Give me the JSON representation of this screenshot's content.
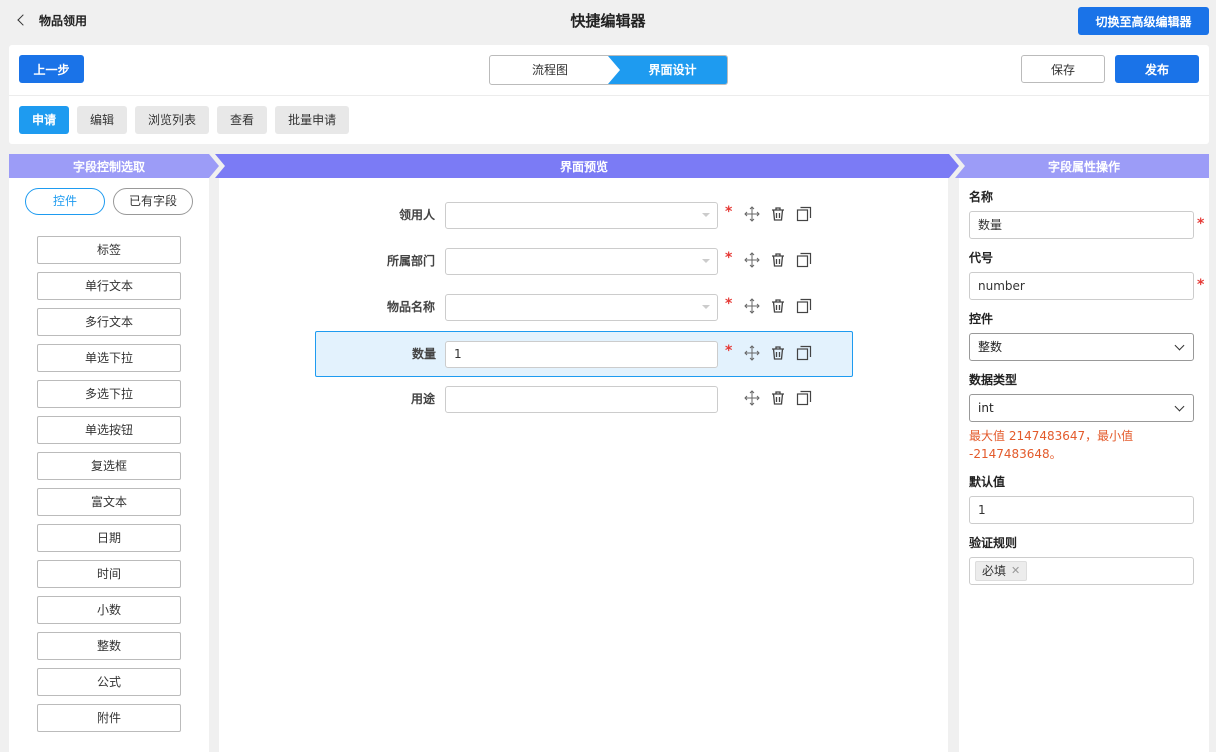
{
  "header": {
    "back_label": "物品领用",
    "title": "快捷编辑器",
    "advanced_button": "切换至高级编辑器"
  },
  "toolbar": {
    "prev_label": "上一步",
    "steps": [
      "流程图",
      "界面设计"
    ],
    "active_step": "界面设计",
    "save_label": "保存",
    "publish_label": "发布",
    "tabs": [
      "申请",
      "编辑",
      "浏览列表",
      "查看",
      "批量申请"
    ],
    "active_tab": "申请"
  },
  "sections": {
    "left": "字段控制选取",
    "middle": "界面预览",
    "right": "字段属性操作"
  },
  "left_panel": {
    "segments": [
      "控件",
      "已有字段"
    ],
    "active_segment": "控件",
    "controls": [
      "标签",
      "单行文本",
      "多行文本",
      "单选下拉",
      "多选下拉",
      "单选按钮",
      "复选框",
      "富文本",
      "日期",
      "时间",
      "小数",
      "整数",
      "公式",
      "附件"
    ]
  },
  "form": {
    "fields": [
      {
        "label": "领用人",
        "value": "",
        "type": "select",
        "required": true,
        "required_mark": "*"
      },
      {
        "label": "所属部门",
        "value": "",
        "type": "select",
        "required": true,
        "required_mark": "*"
      },
      {
        "label": "物品名称",
        "value": "",
        "type": "select",
        "required": true,
        "required_mark": "*"
      },
      {
        "label": "数量",
        "value": "1",
        "type": "input",
        "required": true,
        "required_mark": "*",
        "selected": true
      },
      {
        "label": "用途",
        "value": "",
        "type": "input",
        "required": false
      }
    ]
  },
  "properties": {
    "name_label": "名称",
    "name_value": "数量",
    "code_label": "代号",
    "code_value": "number",
    "control_label": "控件",
    "control_value": "整数",
    "datatype_label": "数据类型",
    "datatype_value": "int",
    "range_hint": "最大值 2147483647，最小值 -2147483648。",
    "default_label": "默认值",
    "default_value": "1",
    "validation_label": "验证规则",
    "validation_tag": "必填",
    "required_mark": "*"
  },
  "colors": {
    "primary": "#1a73e8",
    "accent": "#1e9bf0",
    "banner": "#8c8cfa",
    "required": "#e53935",
    "hint": "#e35a2b"
  }
}
